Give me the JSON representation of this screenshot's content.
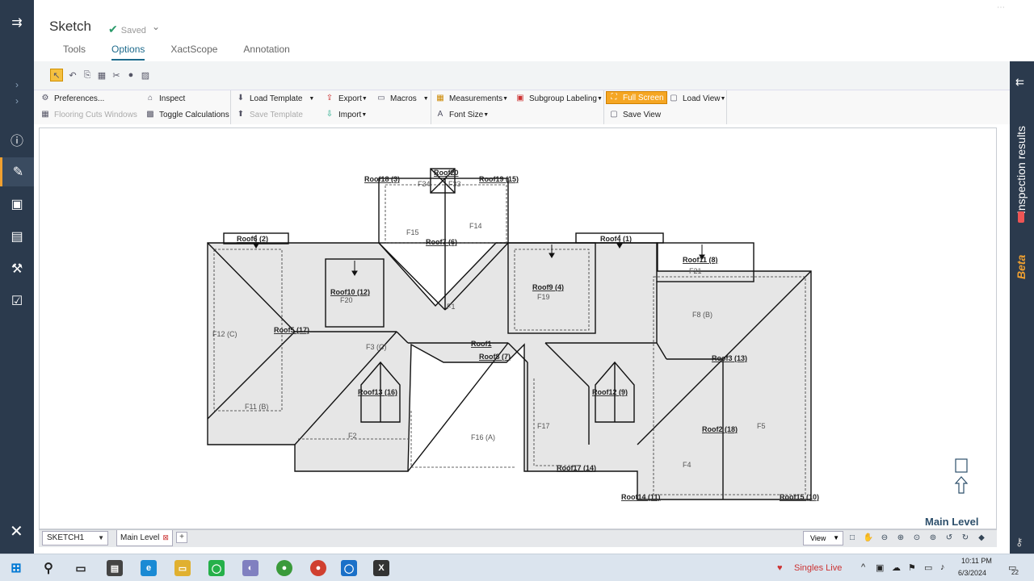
{
  "app": {
    "title": "Sketch",
    "saved_label": "Saved",
    "tabs": [
      "Tools",
      "Options",
      "XactScope",
      "Annotation"
    ],
    "active_tab": "Options"
  },
  "ribbon": {
    "preferences": "Preferences...",
    "flooring_cuts": "Flooring Cuts Windows",
    "inspect": "Inspect",
    "toggle_calc": "Toggle Calculations",
    "load_template": "Load Template",
    "save_template": "Save Template",
    "export": "Export",
    "import": "Import",
    "macros": "Macros",
    "measurements": "Measurements",
    "font_size": "Font Size",
    "subgroup_labeling": "Subgroup Labeling",
    "full_screen": "Full Screen",
    "load_view": "Load View",
    "save_view": "Save View"
  },
  "right_panel": {
    "label": "Inspection results",
    "beta": "Beta"
  },
  "canvas": {
    "level_label": "Main Level",
    "compass_letter": "N",
    "labels": [
      "Roof18 (3)",
      "Roof20",
      "Roof19 (15)",
      "F34",
      "F33",
      "F15",
      "F14",
      "Roof7 (6)",
      "Roof6 (2)",
      "Roof4 (1)",
      "Roof11 (8)",
      "F21",
      "Roof10 (12)",
      "F20",
      "F1",
      "Roof9 (4)",
      "F19",
      "F8 (B)",
      "F12 (C)",
      "Roof5 (17)",
      "F3 (C)",
      "Roof1",
      "Roof8 (7)",
      "Roof3 (13)",
      "Roof13 (16)",
      "Roof12 (9)",
      "F11 (B)",
      "F17",
      "F16 (A)",
      "F2",
      "Roof2 (18)",
      "F5",
      "F4",
      "Roof17 (14)",
      "Roof14 (11)",
      "Roof15 (10)"
    ]
  },
  "bottom": {
    "sketch_name": "SKETCH1",
    "level_tab": "Main Level",
    "add_tab": "+",
    "view_label": "View"
  },
  "taskbar": {
    "singles_live": "Singles Live",
    "time": "10:11 PM",
    "date": "6/3/2024",
    "notif_count": "22"
  }
}
